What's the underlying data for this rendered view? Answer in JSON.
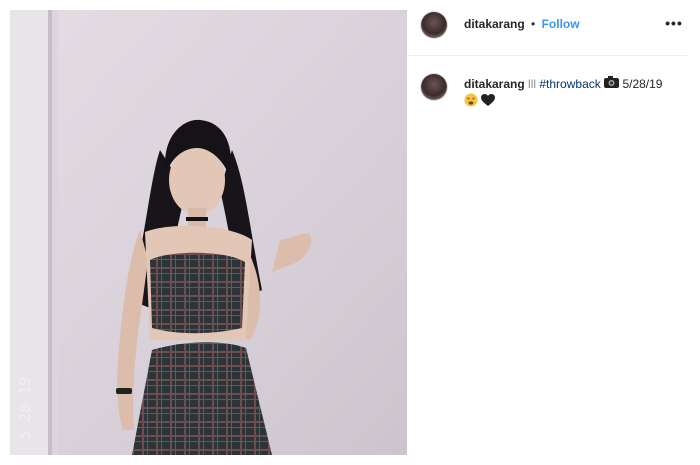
{
  "post": {
    "username": "ditakarang",
    "separator": "•",
    "follow_label": "Follow",
    "more_label": "•••",
    "caption": {
      "username": "ditakarang",
      "text_before": "lll",
      "hashtag": "#throwback",
      "date_text": "5/28/19",
      "emojis": [
        "camera-emoji",
        "weary-face-emoji",
        "black-heart-emoji"
      ]
    },
    "photo_date_stamp": "5 28 19"
  }
}
